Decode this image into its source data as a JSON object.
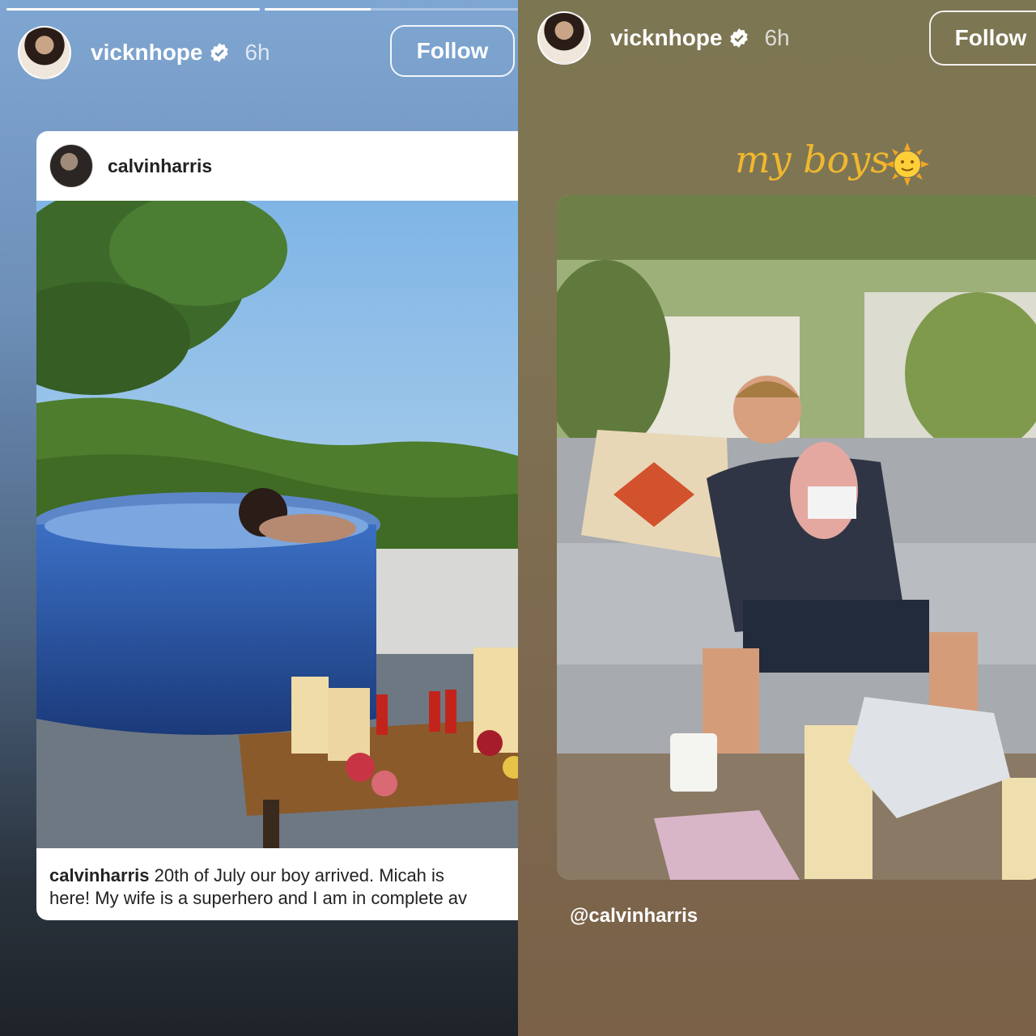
{
  "left_story": {
    "username": "vicknhope",
    "time": "6h",
    "follow_label": "Follow",
    "progress": [
      1.0,
      0.5
    ],
    "post": {
      "username": "calvinharris",
      "caption_user": "calvinharris",
      "caption_line1": "20th of July our boy arrived. Micah is",
      "caption_line2": "here! My wife is a superhero and I am in complete av"
    }
  },
  "right_story": {
    "username": "vicknhope",
    "time": "6h",
    "follow_label": "Follow",
    "sticker_text": "my boys",
    "mention": "@calvinharris"
  },
  "icons": {
    "verified": "verified-badge-icon",
    "sun": "sun-emoji-icon"
  },
  "colors": {
    "sticker": "#f0b72e",
    "left_bg_top": "#7fa6d2",
    "right_bg": "#7d7653"
  }
}
